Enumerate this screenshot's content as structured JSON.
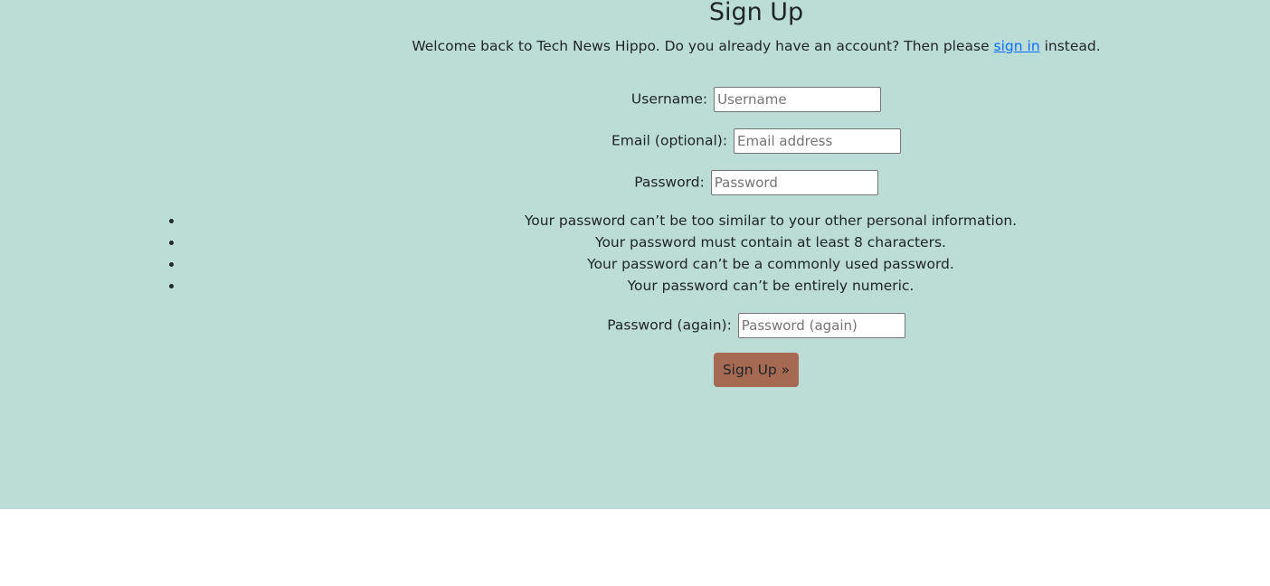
{
  "page": {
    "title": "Sign Up",
    "welcome_before": "Welcome back to Tech News Hippo. Do you already have an account? Then please ",
    "sign_in_link": "sign in",
    "welcome_after": " instead."
  },
  "form": {
    "username": {
      "label": "Username:",
      "placeholder": "Username",
      "value": ""
    },
    "email": {
      "label": "Email (optional):",
      "placeholder": "Email address",
      "value": ""
    },
    "password": {
      "label": "Password:",
      "placeholder": "Password",
      "value": ""
    },
    "password_rules": [
      "Your password can’t be too similar to your other personal information.",
      "Your password must contain at least 8 characters.",
      "Your password can’t be a commonly used password.",
      "Your password can’t be entirely numeric."
    ],
    "password2": {
      "label": "Password (again):",
      "placeholder": "Password (again)",
      "value": ""
    },
    "submit_label": "Sign Up »"
  },
  "colors": {
    "background": "#bcddd6",
    "button": "#a66a53",
    "link": "#0d6efd"
  }
}
